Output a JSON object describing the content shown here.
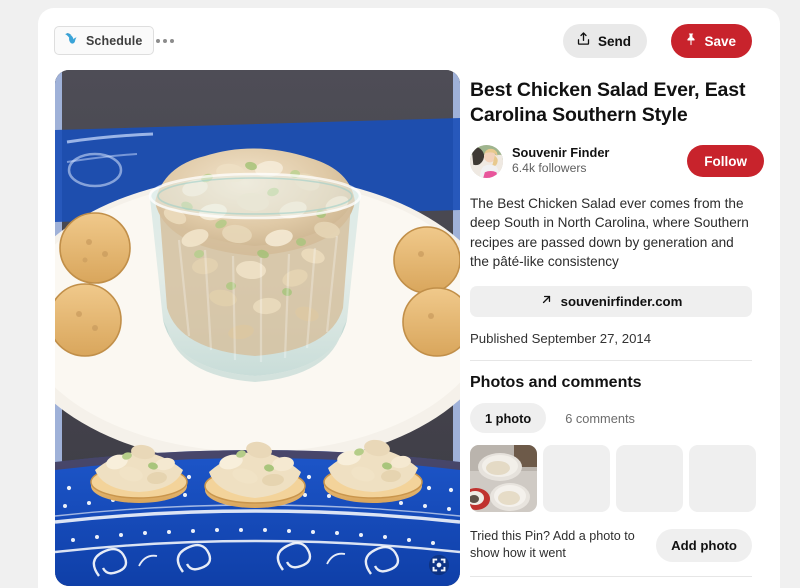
{
  "toolbar": {
    "schedule_label": "Schedule",
    "schedule_icon": "tailwind-bird-icon",
    "more_icon": "more-horizontal-icon",
    "send_label": "Send",
    "send_icon": "share-upload-icon",
    "save_label": "Save",
    "save_icon": "pin-icon",
    "save_color": "#c8232c"
  },
  "pin": {
    "image_alt": "Glass bowl of chicken salad on a blue paisley plate surrounded by round crackers, with three crackers topped with chicken salad below",
    "expand_icon": "expand-fullscreen-icon",
    "title": "Best Chicken Salad Ever, East Carolina Southern Style",
    "description": "The Best Chicken Salad ever comes from the deep South in North Carolina, where Southern recipes are passed down by generation and the pâté-like consistency",
    "link_label": "souvenirfinder.com",
    "link_icon": "external-arrow-icon",
    "published": "Published September 27, 2014"
  },
  "author": {
    "avatar_icon": "user-avatar",
    "name": "Souvenir Finder",
    "followers": "6.4k followers",
    "follow_label": "Follow",
    "follow_color": "#c8232c"
  },
  "activity": {
    "section_title": "Photos and comments",
    "tabs": [
      {
        "label": "1 photo",
        "active": true
      },
      {
        "label": "6 comments",
        "active": false
      }
    ],
    "thumbnails": [
      {
        "name": "photo-thumbnail-1",
        "has_image": true
      },
      {
        "name": "photo-thumbnail-placeholder-1",
        "has_image": false
      },
      {
        "name": "photo-thumbnail-placeholder-2",
        "has_image": false
      },
      {
        "name": "photo-thumbnail-placeholder-3",
        "has_image": false
      }
    ],
    "tried_prompt": "Tried this Pin? Add a photo to show how it went",
    "add_photo_label": "Add photo"
  }
}
